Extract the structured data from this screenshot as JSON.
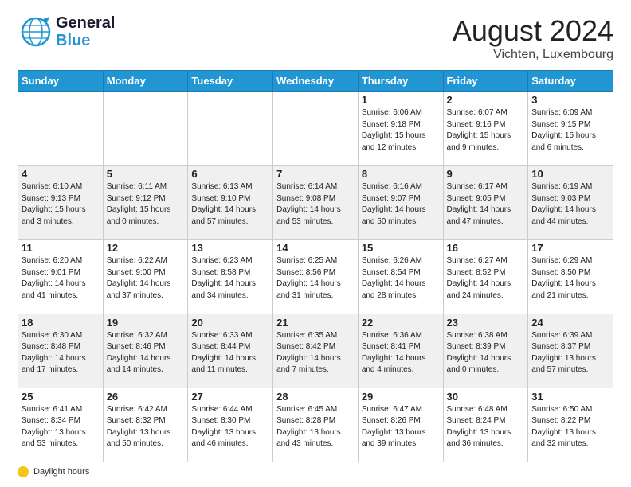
{
  "header": {
    "logo_line1": "General",
    "logo_line2": "Blue",
    "month": "August 2024",
    "location": "Vichten, Luxembourg"
  },
  "weekdays": [
    "Sunday",
    "Monday",
    "Tuesday",
    "Wednesday",
    "Thursday",
    "Friday",
    "Saturday"
  ],
  "weeks": [
    [
      {
        "day": "",
        "info": ""
      },
      {
        "day": "",
        "info": ""
      },
      {
        "day": "",
        "info": ""
      },
      {
        "day": "",
        "info": ""
      },
      {
        "day": "1",
        "info": "Sunrise: 6:06 AM\nSunset: 9:18 PM\nDaylight: 15 hours\nand 12 minutes."
      },
      {
        "day": "2",
        "info": "Sunrise: 6:07 AM\nSunset: 9:16 PM\nDaylight: 15 hours\nand 9 minutes."
      },
      {
        "day": "3",
        "info": "Sunrise: 6:09 AM\nSunset: 9:15 PM\nDaylight: 15 hours\nand 6 minutes."
      }
    ],
    [
      {
        "day": "4",
        "info": "Sunrise: 6:10 AM\nSunset: 9:13 PM\nDaylight: 15 hours\nand 3 minutes."
      },
      {
        "day": "5",
        "info": "Sunrise: 6:11 AM\nSunset: 9:12 PM\nDaylight: 15 hours\nand 0 minutes."
      },
      {
        "day": "6",
        "info": "Sunrise: 6:13 AM\nSunset: 9:10 PM\nDaylight: 14 hours\nand 57 minutes."
      },
      {
        "day": "7",
        "info": "Sunrise: 6:14 AM\nSunset: 9:08 PM\nDaylight: 14 hours\nand 53 minutes."
      },
      {
        "day": "8",
        "info": "Sunrise: 6:16 AM\nSunset: 9:07 PM\nDaylight: 14 hours\nand 50 minutes."
      },
      {
        "day": "9",
        "info": "Sunrise: 6:17 AM\nSunset: 9:05 PM\nDaylight: 14 hours\nand 47 minutes."
      },
      {
        "day": "10",
        "info": "Sunrise: 6:19 AM\nSunset: 9:03 PM\nDaylight: 14 hours\nand 44 minutes."
      }
    ],
    [
      {
        "day": "11",
        "info": "Sunrise: 6:20 AM\nSunset: 9:01 PM\nDaylight: 14 hours\nand 41 minutes."
      },
      {
        "day": "12",
        "info": "Sunrise: 6:22 AM\nSunset: 9:00 PM\nDaylight: 14 hours\nand 37 minutes."
      },
      {
        "day": "13",
        "info": "Sunrise: 6:23 AM\nSunset: 8:58 PM\nDaylight: 14 hours\nand 34 minutes."
      },
      {
        "day": "14",
        "info": "Sunrise: 6:25 AM\nSunset: 8:56 PM\nDaylight: 14 hours\nand 31 minutes."
      },
      {
        "day": "15",
        "info": "Sunrise: 6:26 AM\nSunset: 8:54 PM\nDaylight: 14 hours\nand 28 minutes."
      },
      {
        "day": "16",
        "info": "Sunrise: 6:27 AM\nSunset: 8:52 PM\nDaylight: 14 hours\nand 24 minutes."
      },
      {
        "day": "17",
        "info": "Sunrise: 6:29 AM\nSunset: 8:50 PM\nDaylight: 14 hours\nand 21 minutes."
      }
    ],
    [
      {
        "day": "18",
        "info": "Sunrise: 6:30 AM\nSunset: 8:48 PM\nDaylight: 14 hours\nand 17 minutes."
      },
      {
        "day": "19",
        "info": "Sunrise: 6:32 AM\nSunset: 8:46 PM\nDaylight: 14 hours\nand 14 minutes."
      },
      {
        "day": "20",
        "info": "Sunrise: 6:33 AM\nSunset: 8:44 PM\nDaylight: 14 hours\nand 11 minutes."
      },
      {
        "day": "21",
        "info": "Sunrise: 6:35 AM\nSunset: 8:42 PM\nDaylight: 14 hours\nand 7 minutes."
      },
      {
        "day": "22",
        "info": "Sunrise: 6:36 AM\nSunset: 8:41 PM\nDaylight: 14 hours\nand 4 minutes."
      },
      {
        "day": "23",
        "info": "Sunrise: 6:38 AM\nSunset: 8:39 PM\nDaylight: 14 hours\nand 0 minutes."
      },
      {
        "day": "24",
        "info": "Sunrise: 6:39 AM\nSunset: 8:37 PM\nDaylight: 13 hours\nand 57 minutes."
      }
    ],
    [
      {
        "day": "25",
        "info": "Sunrise: 6:41 AM\nSunset: 8:34 PM\nDaylight: 13 hours\nand 53 minutes."
      },
      {
        "day": "26",
        "info": "Sunrise: 6:42 AM\nSunset: 8:32 PM\nDaylight: 13 hours\nand 50 minutes."
      },
      {
        "day": "27",
        "info": "Sunrise: 6:44 AM\nSunset: 8:30 PM\nDaylight: 13 hours\nand 46 minutes."
      },
      {
        "day": "28",
        "info": "Sunrise: 6:45 AM\nSunset: 8:28 PM\nDaylight: 13 hours\nand 43 minutes."
      },
      {
        "day": "29",
        "info": "Sunrise: 6:47 AM\nSunset: 8:26 PM\nDaylight: 13 hours\nand 39 minutes."
      },
      {
        "day": "30",
        "info": "Sunrise: 6:48 AM\nSunset: 8:24 PM\nDaylight: 13 hours\nand 36 minutes."
      },
      {
        "day": "31",
        "info": "Sunrise: 6:50 AM\nSunset: 8:22 PM\nDaylight: 13 hours\nand 32 minutes."
      }
    ]
  ],
  "footer": {
    "label": "Daylight hours"
  }
}
